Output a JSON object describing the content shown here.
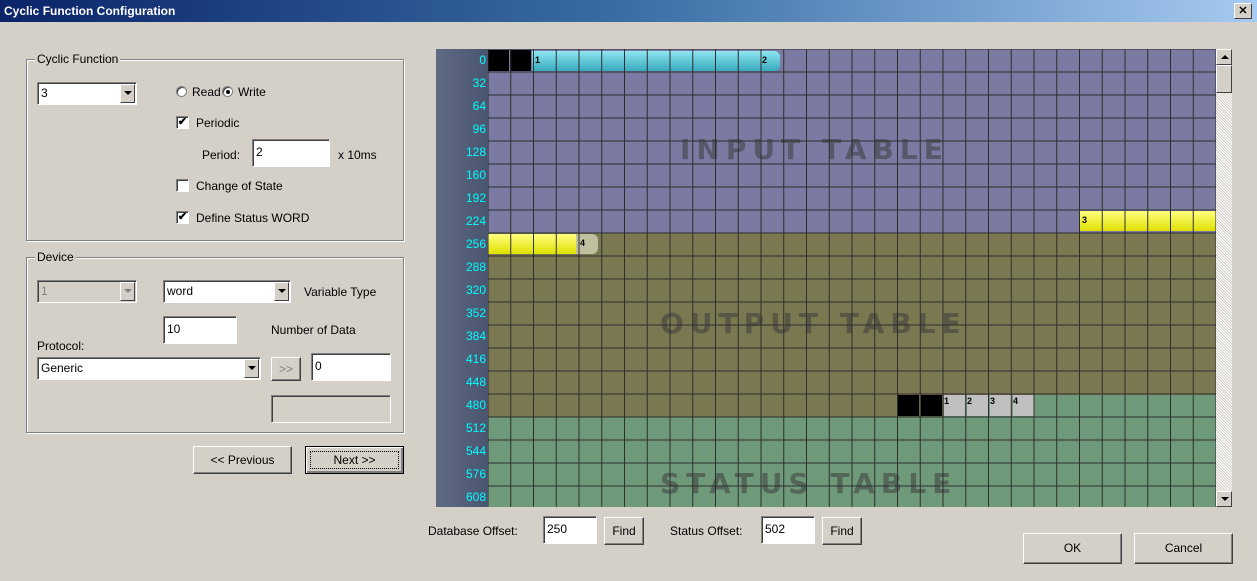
{
  "window": {
    "title": "Cyclic Function Configuration",
    "close_glyph": "✕"
  },
  "cyclic_function": {
    "group_label": "Cyclic Function",
    "selected": "3",
    "read_label": "Read",
    "write_label": "Write",
    "mode": "write",
    "periodic_label": "Periodic",
    "periodic_checked": true,
    "period_label": "Period:",
    "period_value": "2",
    "period_unit": "x 10ms",
    "change_of_state_label": "Change of State",
    "change_of_state_checked": false,
    "status_word_label": "Define Status WORD",
    "status_word_checked": true
  },
  "device": {
    "group_label": "Device",
    "device_value": "1",
    "variable_type_value": "word",
    "variable_type_label": "Variable Type",
    "number_of_data_value": "10",
    "number_of_data_label": "Number of Data",
    "protocol_label": "Protocol:",
    "protocol_value": "Generic",
    "arrow_button_label": ">>",
    "offset_value": "0",
    "extra_value": ""
  },
  "nav": {
    "previous_label": "<< Previous",
    "next_label": "Next >>"
  },
  "grid": {
    "row_labels": [
      "0",
      "32",
      "64",
      "96",
      "128",
      "160",
      "192",
      "224",
      "256",
      "288",
      "320",
      "352",
      "384",
      "416",
      "448",
      "480",
      "512",
      "544",
      "576",
      "608"
    ],
    "input_label": "INPUT TABLE",
    "output_label": "OUTPUT TABLE",
    "status_label": "STATUS TABLE",
    "colors": {
      "input": "#7a7aa3",
      "output": "#7a7850",
      "status": "#6f9a7a",
      "cyan_seg": "#5ec8d8",
      "yellow_seg": "#f0f000"
    },
    "markers": {
      "m1": "1",
      "m2": "2",
      "m3": "3",
      "m4": "4"
    },
    "status_chips": [
      "1",
      "2",
      "3",
      "4"
    ]
  },
  "footer": {
    "db_offset_label": "Database Offset:",
    "db_offset_value": "250",
    "find_label": "Find",
    "status_offset_label": "Status Offset:",
    "status_offset_value": "502",
    "ok_label": "OK",
    "cancel_label": "Cancel"
  }
}
